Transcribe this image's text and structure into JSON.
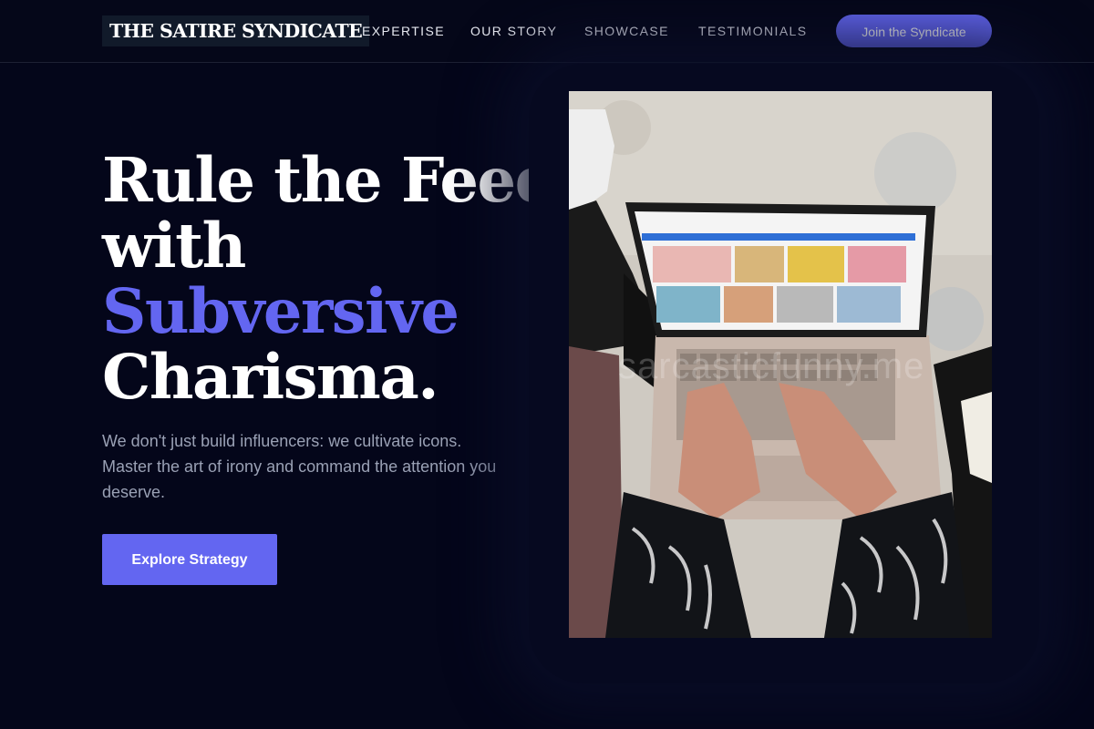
{
  "brand": {
    "name": "THE SATIRE SYNDICATE",
    "accent_color": "#6366f1",
    "background_color": "#04061a"
  },
  "nav": {
    "links": [
      "EXPERTISE",
      "OUR STORY",
      "SHOWCASE",
      "TESTIMONIALS"
    ],
    "cta_label": "Join the Syndicate"
  },
  "hero": {
    "headline": {
      "line1": "Rule the Feed",
      "line2": "with",
      "line3": "Subversive",
      "line4": "Charisma."
    },
    "lede": "We don't just build influencers: we cultivate icons. Master the art of irony and command the attention you deserve.",
    "cta_label": "Explore Strategy"
  },
  "hero_image": {
    "icon": "person-typing-on-laptop-photo",
    "watermark": "sarcasticfunny.me"
  }
}
